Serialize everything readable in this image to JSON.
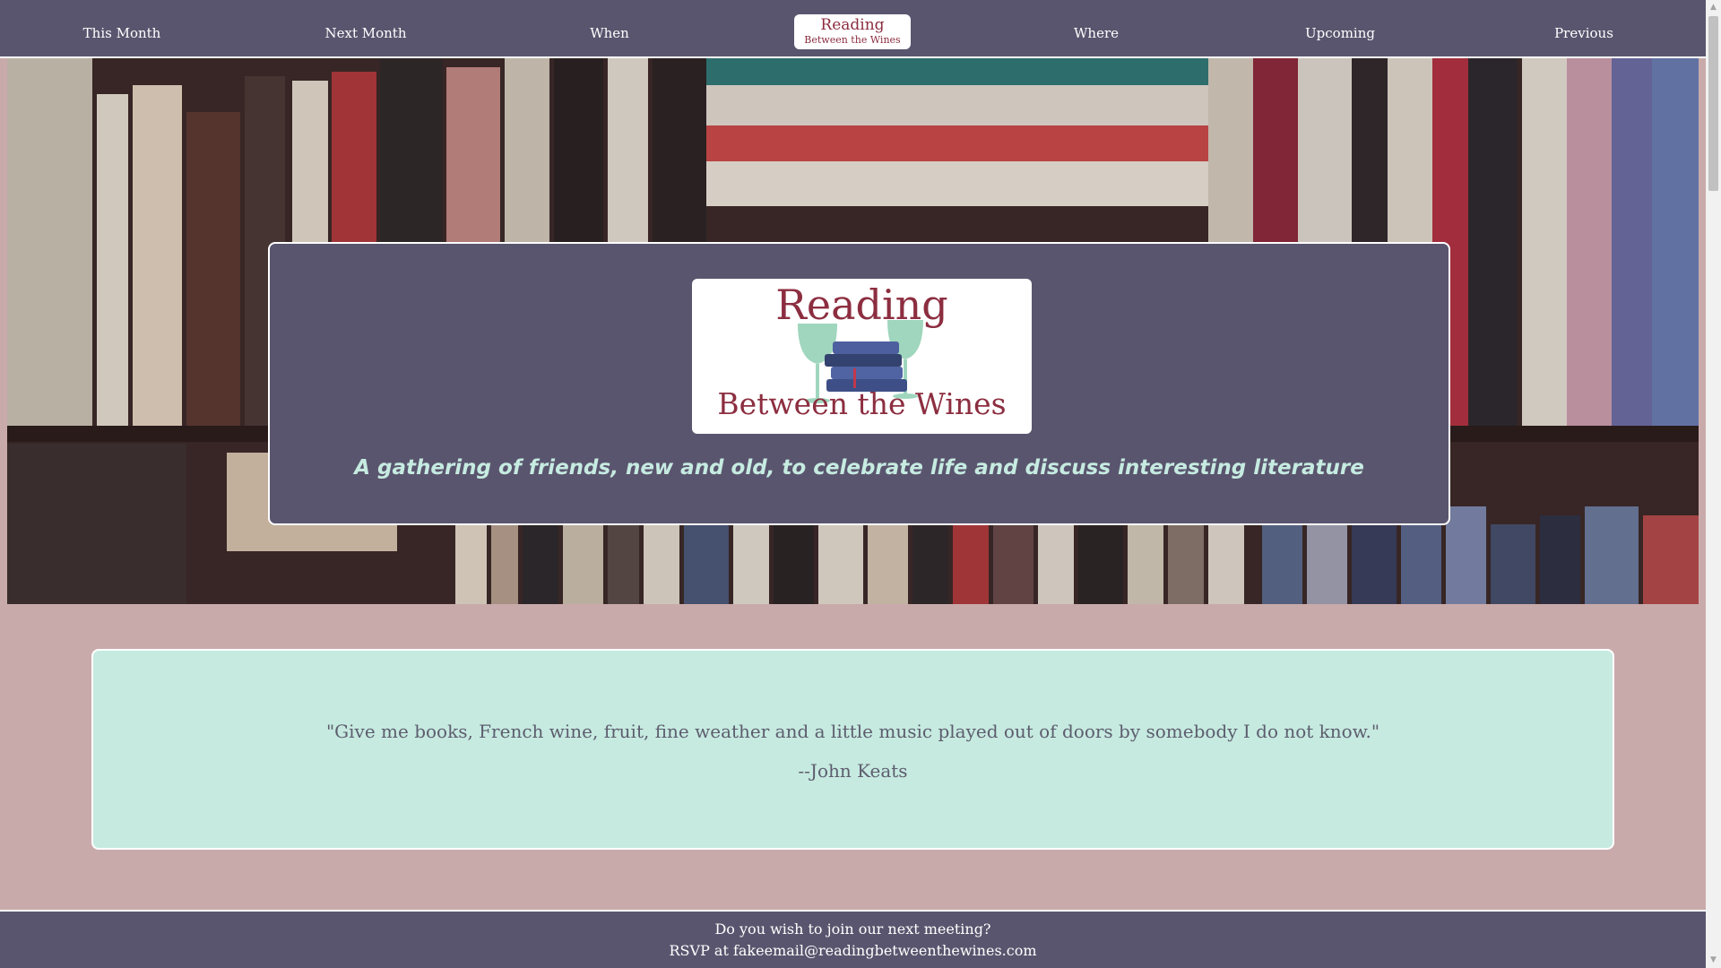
{
  "nav": {
    "items": [
      {
        "label": "This Month"
      },
      {
        "label": "Next Month"
      },
      {
        "label": "When"
      },
      {
        "label": "Where"
      },
      {
        "label": "Upcoming"
      },
      {
        "label": "Previous"
      }
    ],
    "logo": {
      "line1": "Reading",
      "line2": "Between the Wines"
    }
  },
  "hero": {
    "logo": {
      "top": "Reading",
      "bottom": "Between the Wines"
    },
    "tagline": "A gathering of friends, new and old, to celebrate life and discuss interesting literature"
  },
  "quote": {
    "text": "\"Give me books, French wine, fruit, fine weather and a little music played out of doors by somebody I do not know.\"",
    "author": "--John Keats"
  },
  "footer": {
    "line1": "Do you wish to join our next meeting?",
    "line2": "RSVP at fakeemail@readingbetweenthewines.com"
  },
  "colors": {
    "nav_bg": "#5a556e",
    "page_bg": "#c9aaab",
    "quote_bg": "#c6eae0",
    "tagline": "#c6ebe1",
    "logo_text": "#8c2e40"
  },
  "icons": {
    "scroll_up": "triangle-up-icon",
    "scroll_down": "triangle-down-icon"
  }
}
